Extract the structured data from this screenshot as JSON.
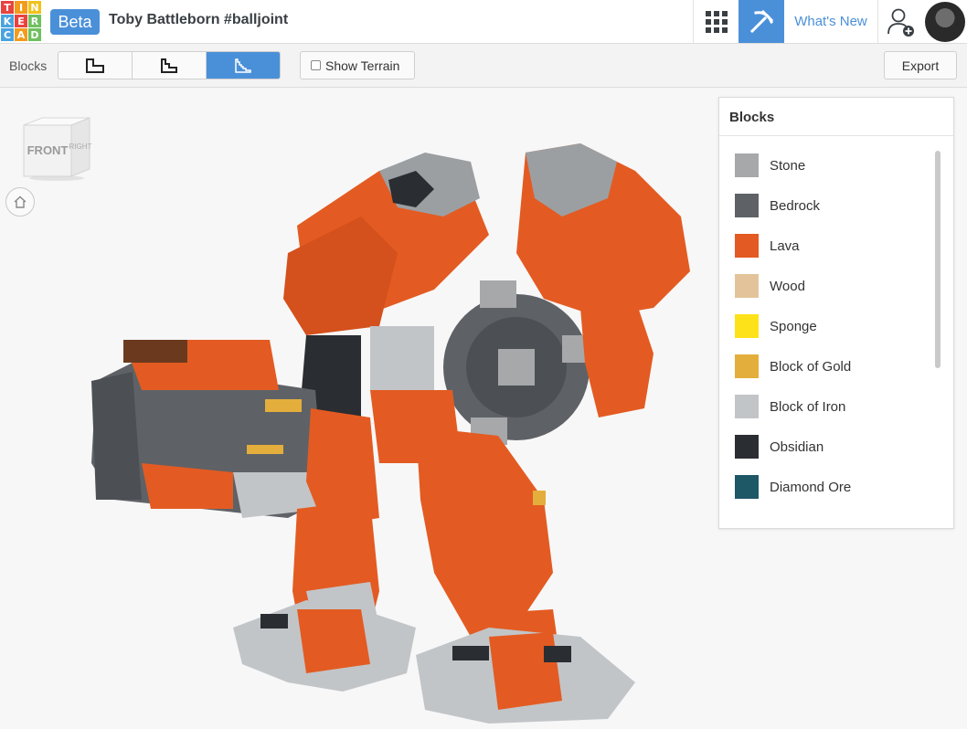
{
  "header": {
    "logo_letters": [
      "T",
      "I",
      "N",
      "K",
      "E",
      "R",
      "C",
      "A",
      "D"
    ],
    "logo_colors": [
      "#e8433f",
      "#f39b1b",
      "#f1c21b",
      "#4aa3df",
      "#e8433f",
      "#6fc05f",
      "#4aa3df",
      "#f39b1b",
      "#6fc05f"
    ],
    "badge": "Beta",
    "title": "Toby Battleborn #balljoint",
    "whats_new": "What's New",
    "accent": "#4a90d9"
  },
  "toolbar": {
    "blocks_label": "Blocks",
    "show_terrain": "Show Terrain",
    "export": "Export"
  },
  "viewcube": {
    "front": "FRONT",
    "right": "RIGHT"
  },
  "panel": {
    "title": "Blocks",
    "items": [
      {
        "label": "Stone",
        "color": "#a6a8aa"
      },
      {
        "label": "Bedrock",
        "color": "#5e6266"
      },
      {
        "label": "Lava",
        "color": "#e35b22"
      },
      {
        "label": "Wood",
        "color": "#e3c49a"
      },
      {
        "label": "Sponge",
        "color": "#fde21a"
      },
      {
        "label": "Block of Gold",
        "color": "#e4ae3c"
      },
      {
        "label": "Block of Iron",
        "color": "#c2c5c8"
      },
      {
        "label": "Obsidian",
        "color": "#2a2d31"
      },
      {
        "label": "Diamond Ore",
        "color": "#1e5766"
      }
    ]
  }
}
